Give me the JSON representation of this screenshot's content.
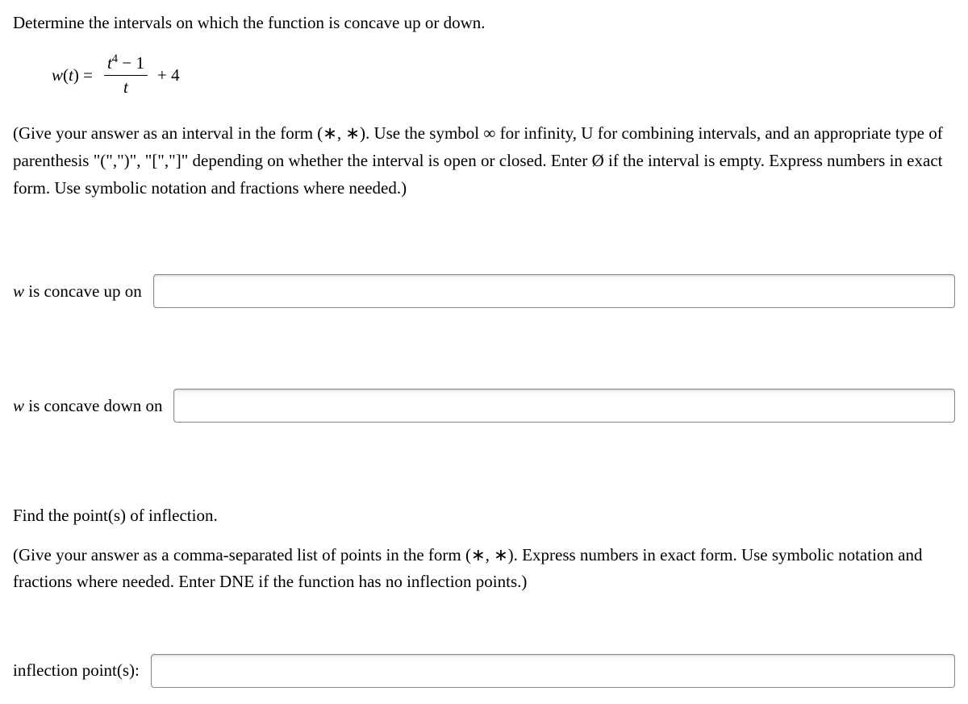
{
  "question": {
    "prompt": "Determine the intervals on which the function is concave up or down.",
    "formula": {
      "lhs_var": "w",
      "lhs_arg": "t",
      "numerator_var": "t",
      "numerator_exp": "4",
      "numerator_minus": " − 1",
      "denominator": "t",
      "plus_term": " + 4"
    },
    "instruction1": "(Give your answer as an interval in the form (∗, ∗). Use the symbol ∞ for infinity, U for combining intervals, and an appropriate type of parenthesis \"(\",\")\", \"[\",\"]\" depending on whether the interval is open or closed. Enter Ø if the interval is empty. Express numbers in exact form. Use symbolic notation and fractions where needed.)"
  },
  "answers": {
    "concave_up": {
      "var": "w",
      "suffix": " is concave up on",
      "value": ""
    },
    "concave_down": {
      "var": "w",
      "suffix": " is concave down on",
      "value": ""
    }
  },
  "part2": {
    "heading": "Find the point(s) of inflection.",
    "instruction": "(Give your answer as a comma-separated list of points in the form (∗, ∗). Express numbers in exact form. Use symbolic notation and fractions where needed. Enter DNE if the function has no inflection points.)",
    "inflection": {
      "label": "inflection point(s):",
      "value": ""
    }
  }
}
